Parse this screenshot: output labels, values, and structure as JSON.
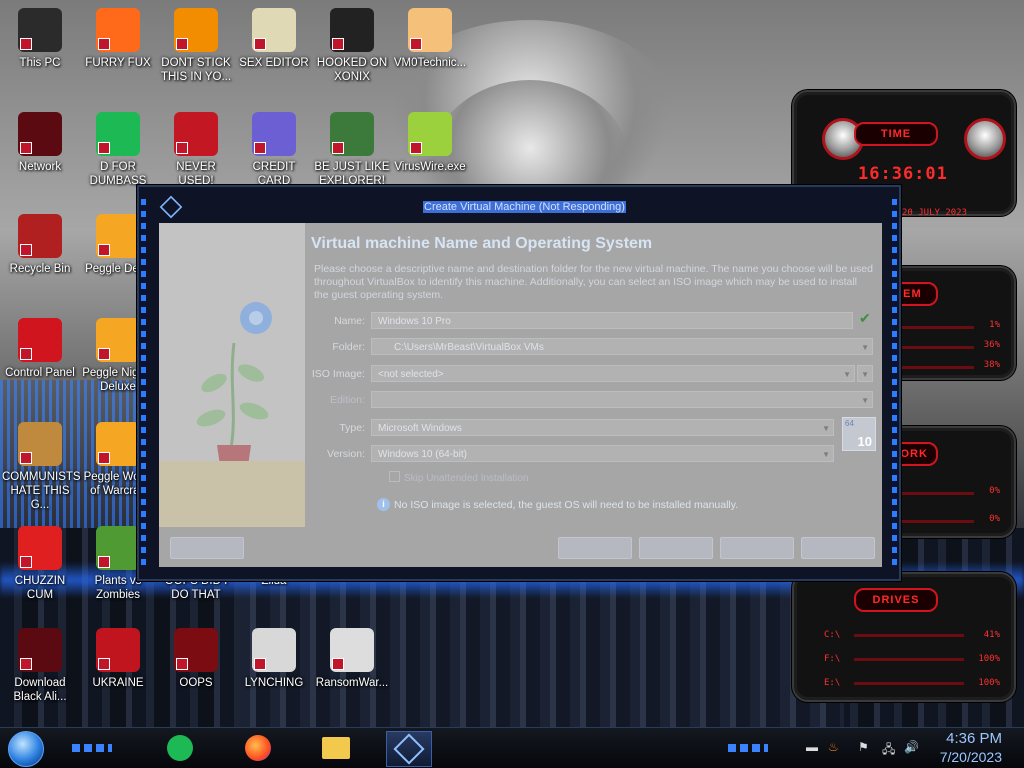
{
  "desktop": {
    "icons": [
      {
        "label": "This PC",
        "icon": "computer-icon",
        "color": "#2b2b2b"
      },
      {
        "label": "FURRY FUX",
        "icon": "firefox-icon",
        "color": "#ff6a1a"
      },
      {
        "label": "DONT STICK THIS IN YO...",
        "icon": "vlc-cone-icon",
        "color": "#f28c00"
      },
      {
        "label": "SEX EDITOR",
        "icon": "hxd-icon",
        "color": "#e0d9b5"
      },
      {
        "label": "HOOKED ON XONIX",
        "icon": "xonix-icon",
        "color": "#222222"
      },
      {
        "label": "VM0Technic...",
        "icon": "doctor-icon",
        "color": "#f5c17a"
      },
      {
        "label": "Network",
        "icon": "alienware-icon",
        "color": "#5a0a10"
      },
      {
        "label": "D FOR DUMBASS",
        "icon": "document-icon",
        "color": "#1db954"
      },
      {
        "label": "NEVER USED!",
        "icon": "devcpp-icon",
        "color": "#c31823"
      },
      {
        "label": "CREDIT CARD STEALER",
        "icon": "credit-card-icon",
        "color": "#6b5fd3"
      },
      {
        "label": "BE JUST LIKE EXPLORER!",
        "icon": "elf-icon",
        "color": "#3b7a3b"
      },
      {
        "label": "VirusWire.exe",
        "icon": "lime-icon",
        "color": "#9bd13c"
      },
      {
        "label": "Recycle Bin",
        "icon": "recycle-bin-icon",
        "color": "#b02020"
      },
      {
        "label": "Peggle Del...",
        "icon": "peggle-icon",
        "color": "#f5a623"
      },
      {
        "label": "Control Panel",
        "icon": "control-panel-icon",
        "color": "#d0151f"
      },
      {
        "label": "Peggle Nights Deluxe",
        "icon": "peggle-nights-icon",
        "color": "#f5a623"
      },
      {
        "label": "COMMUNISTS HATE THIS G...",
        "icon": "money-bag-icon",
        "color": "#c08a3e"
      },
      {
        "label": "Peggle World of Warcraft",
        "icon": "peggle-wow-icon",
        "color": "#f5a623"
      },
      {
        "label": "CHUZZIN CUM",
        "icon": "chuzzle-icon",
        "color": "#e02020"
      },
      {
        "label": "Plants vs Zombies",
        "icon": "plants-zombies-icon",
        "color": "#4f9a32"
      },
      {
        "label": "OOPS DID I DO THAT",
        "icon": "blank-icon",
        "color": "#444444"
      },
      {
        "label": "Zilda",
        "icon": "zelda-icon",
        "color": "#555555"
      },
      {
        "label": "Download Black Ali...",
        "icon": "alienware-icon",
        "color": "#5a0a10"
      },
      {
        "label": "UKRAINE",
        "icon": "radiation-icon",
        "color": "#c0151f"
      },
      {
        "label": "OOPS",
        "icon": "oops-icon",
        "color": "#7a0c12"
      },
      {
        "label": "LYNCHING",
        "icon": "rope-icon",
        "color": "#d8d8d8"
      },
      {
        "label": "RansomWar...",
        "icon": "skull-icon",
        "color": "#dddddd"
      }
    ]
  },
  "widgets": {
    "time_tag": "TIME",
    "clock": "16:36:01",
    "date": "20 JULY 2023",
    "system_tag": "SYSTEM",
    "system_values": [
      "1%",
      "36%",
      "38%"
    ],
    "network_tag": "NETWORK",
    "network_values": [
      "0%",
      "0%"
    ],
    "drives_tag": "DRIVES",
    "drives": [
      {
        "name": "C:\\",
        "value": "41%"
      },
      {
        "name": "F:\\",
        "value": "100%"
      },
      {
        "name": "E:\\",
        "value": "100%"
      }
    ],
    "accent": "#ff2a2a"
  },
  "dialog": {
    "title": "Create Virtual Machine (Not Responding)",
    "heading": "Virtual machine Name and Operating System",
    "description": "Please choose a descriptive name and destination folder for the new virtual machine. The name you choose will be used throughout VirtualBox to identify this machine. Additionally, you can select an ISO image which may be used to install the guest operating system.",
    "fields": {
      "name_label": "Name:",
      "name_value": "Windows 10 Pro",
      "folder_label": "Folder:",
      "folder_value": "C:\\Users\\MrBeast\\VirtualBox VMs",
      "iso_label": "ISO Image:",
      "iso_value": "<not selected>",
      "edition_label": "Edition:",
      "edition_value": "",
      "type_label": "Type:",
      "type_value": "Microsoft Windows",
      "version_label": "Version:",
      "version_value": "Windows 10 (64-bit)"
    },
    "os_badge": "10",
    "os_badge_bits": "64",
    "skip_unattended": "Skip Unattended Installation",
    "info_text": "No ISO image is selected, the guest OS will need to be installed manually."
  },
  "taskbar": {
    "time": "4:36 PM",
    "date": "7/20/2023",
    "accent": "#3b82ff"
  }
}
